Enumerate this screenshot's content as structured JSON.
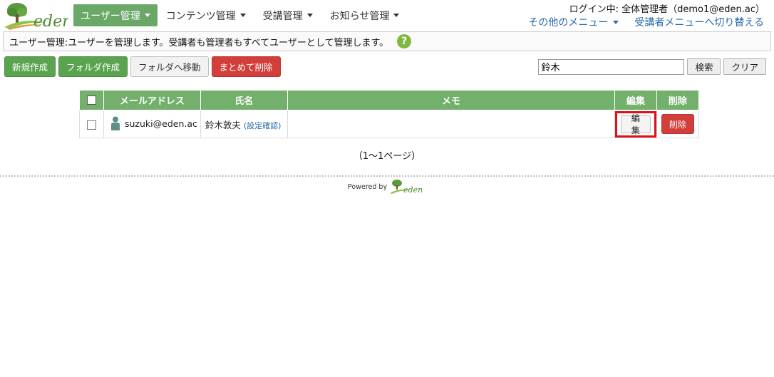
{
  "logo": {
    "text": "eden"
  },
  "nav": {
    "items": [
      {
        "label": "ユーザー管理",
        "active": true
      },
      {
        "label": "コンテンツ管理",
        "active": false
      },
      {
        "label": "受講管理",
        "active": false
      },
      {
        "label": "お知らせ管理",
        "active": false
      }
    ]
  },
  "header": {
    "login_info": "ログイン中: 全体管理者（demo1@eden.ac）",
    "other_menu": "その他のメニュー",
    "switch_menu": "受講者メニューへ切り替える"
  },
  "description": {
    "text": "ユーザー管理:ユーザーを管理します。受講者も管理者もすべてユーザーとして管理します。",
    "help_icon": "?"
  },
  "toolbar": {
    "new_label": "新規作成",
    "new_folder_label": "フォルダ作成",
    "move_to_folder_label": "フォルダへ移動",
    "bulk_delete_label": "まとめて削除"
  },
  "search": {
    "value": "鈴木",
    "search_label": "検索",
    "clear_label": "クリア"
  },
  "table": {
    "headers": {
      "email": "メールアドレス",
      "name": "氏名",
      "memo": "メモ",
      "edit": "編集",
      "delete": "削除"
    },
    "rows": [
      {
        "email": "suzuki@eden.ac",
        "name": "鈴木敦夫",
        "settings_link": "(設定確認)",
        "memo": "",
        "edit_label": "編集",
        "delete_label": "削除"
      }
    ]
  },
  "pagination": {
    "text": "（1～1ページ）"
  },
  "footer": {
    "powered_by": "Powered by",
    "brand": "eden"
  },
  "colors": {
    "nav_active": "#6aa868",
    "table_header": "#72b06b",
    "green_button": "#5aa34f",
    "red_button": "#d23f3a",
    "link": "#2a6aa8",
    "highlight_box": "#e0101a"
  }
}
